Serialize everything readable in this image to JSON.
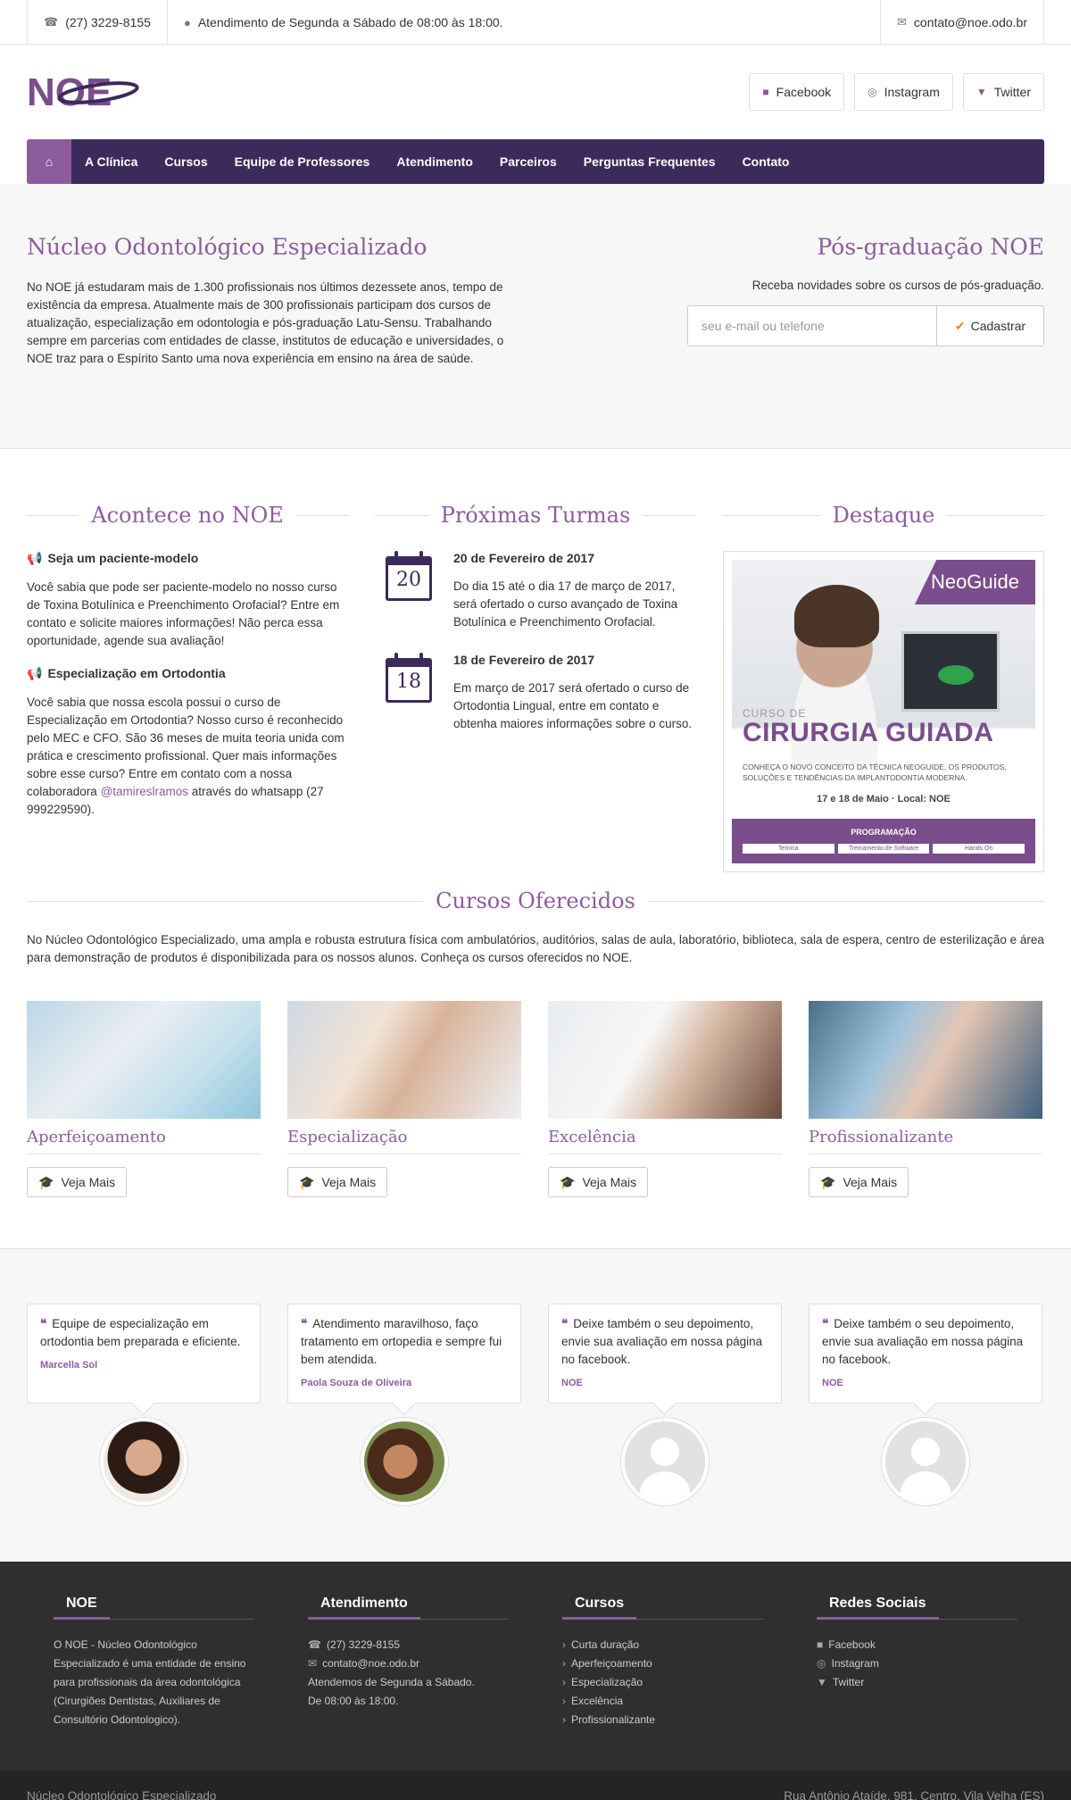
{
  "topbar": {
    "phone": "(27) 3229-8155",
    "hours": "Atendimento de Segunda a Sábado de 08:00 às 18:00.",
    "email": "contato@noe.odo.br"
  },
  "brand": {
    "logo_text": "NOE"
  },
  "social": {
    "facebook": "Facebook",
    "instagram": "Instagram",
    "twitter": "Twitter"
  },
  "nav": [
    "A Clínica",
    "Cursos",
    "Equipe de Professores",
    "Atendimento",
    "Parceiros",
    "Perguntas Frequentes",
    "Contato"
  ],
  "intro": {
    "title": "Núcleo Odontológico Especializado",
    "text": "No NOE já estudaram mais de 1.300 profissionais nos últimos dezessete anos, tempo de existência da empresa. Atualmente mais de 300 profissionais participam dos cursos de atualização, especialização em odontologia e pós-graduação Latu-Sensu. Trabalhando sempre em parcerias com entidades de classe, institutos de educação e universidades, o NOE traz para o Espírito Santo uma nova experiência em ensino na área de saúde.",
    "pos_title": "Pós-graduação NOE",
    "pos_text": "Receba novidades sobre os cursos de pós-graduação.",
    "input_placeholder": "seu e-mail ou telefone",
    "submit": "Cadastrar"
  },
  "acontece": {
    "title": "Acontece no NOE",
    "items": [
      {
        "title": "Seja um paciente-modelo",
        "text": "Você sabia que pode ser paciente-modelo no nosso curso de Toxina Botulínica e Preenchimento Orofacial? Entre em contato e solicite maiores informações! Não perca essa oportunidade, agende sua avaliação!"
      },
      {
        "title": "Especialização em Ortodontia",
        "text_before": "Você sabia que nossa escola possui o curso de Especialização em Ortodontia? Nosso curso é reconhecido pelo MEC e CFO. São 36 meses de muita teoria unida com prática e crescimento profissional. Quer mais informações sobre esse curso? Entre em contato com a nossa colaboradora ",
        "link": "@tamireslramos",
        "text_after": " através do whatsapp (27 999229590)."
      }
    ]
  },
  "turmas": {
    "title": "Próximas Turmas",
    "items": [
      {
        "day": "20",
        "date": "20 de Fevereiro de 2017",
        "text": "Do dia 15 até o dia 17 de março de 2017, será ofertado o curso avançado de Toxina Botulínica e Preenchimento Orofacial."
      },
      {
        "day": "18",
        "date": "18 de Fevereiro de 2017",
        "text": "Em março de 2017 será ofertado o curso de Ortodontia Lingual, entre em contato e obtenha maiores informações sobre o curso."
      }
    ]
  },
  "destaque": {
    "title": "Destaque",
    "brand": "NeoGuide",
    "subtitle": "CURSO DE",
    "headline": "CIRURGIA GUIADA",
    "tagline": "CONHEÇA O NOVO CONCEITO DA TÉCNICA NEOGUIDE, OS PRODUTOS, SOLUÇÕES E TENDÊNCIAS DA IMPLANTODONTIA MODERNA.",
    "dates": "17 e 18 de Maio · Local: NOE",
    "programacao": "PROGRAMAÇÃO",
    "tabs": [
      "Teórica",
      "Treinamento de Software",
      "Hands On"
    ]
  },
  "cursos": {
    "title": "Cursos Oferecidos",
    "text": "No Núcleo Odontológico Especializado, uma ampla e robusta estrutura física com ambulatórios, auditórios, salas de aula, laboratório, biblioteca, sala de espera, centro de esterilização e área para demonstração de produtos é disponibilizada para os nossos alunos. Conheça os cursos oferecidos no NOE.",
    "items": [
      "Aperfeiçoamento",
      "Especialização",
      "Excelência",
      "Profissionalizante"
    ],
    "button": "Veja Mais"
  },
  "testimonials": [
    {
      "text": "Equipe de especialização em ortodontia bem preparada e eficiente.",
      "author": "Marcella Sol"
    },
    {
      "text": "Atendimento maravilhoso, faço tratamento em ortopedia e sempre fui bem atendida.",
      "author": "Paola Souza de Oliveira"
    },
    {
      "text": "Deixe também o seu depoimento, envie sua avaliação em nossa página no facebook.",
      "author": "NOE"
    },
    {
      "text": "Deixe também o seu depoimento, envie sua avaliação em nossa página no facebook.",
      "author": "NOE"
    }
  ],
  "footer": {
    "noe": {
      "title": "NOE",
      "text": "O NOE - Núcleo Odontológico Especializado é uma entidade de ensino para profissionais da área odontológica (Cirurgiões Dentistas, Auxiliares de Consultório Odontologico)."
    },
    "atendimento": {
      "title": "Atendimento",
      "phone": "(27) 3229-8155",
      "email": "contato@noe.odo.br",
      "line1": "Atendemos de Segunda a Sábado.",
      "line2": "De 08:00 às 18:00."
    },
    "cursos": {
      "title": "Cursos",
      "items": [
        "Curta duração",
        "Aperfeiçoamento",
        "Especialização",
        "Excelência",
        "Profissionalizante"
      ]
    },
    "redes": {
      "title": "Redes Sociais",
      "items": [
        "Facebook",
        "Instagram",
        "Twitter"
      ]
    }
  },
  "copyright": {
    "left": "Núcleo Odontológico Especializado",
    "right": "Rua Antônio Ataíde, 981, Centro, Vila Velha (ES)"
  }
}
